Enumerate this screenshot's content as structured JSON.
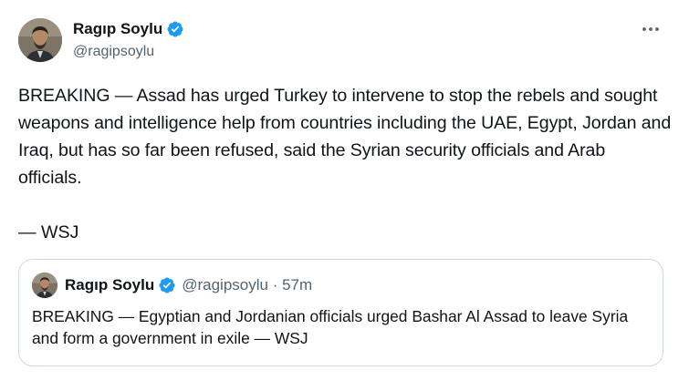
{
  "author": {
    "display_name": "Ragıp Soylu",
    "handle": "@ragipsoylu",
    "avatar_icon": "profile-avatar",
    "verified_icon": "verified-badge-icon"
  },
  "menu": {
    "icon": "more-options-icon"
  },
  "tweet": {
    "text": "BREAKING — Assad has urged Turkey to intervene to stop the rebels and sought weapons and intelligence help from countries including the UAE, Egypt, Jordan and Iraq, but has so far been refused, said the Syrian security officials and Arab officials.",
    "source": "— WSJ"
  },
  "quoted_tweet": {
    "display_name": "Ragıp Soylu",
    "meta": "@ragipsoylu · 57m",
    "text": "BREAKING — Egyptian and Jordanian officials urged Bashar Al Assad to leave Syria and form a government in exile — WSJ"
  },
  "colors": {
    "text": "#0f1419",
    "secondary": "#536471",
    "border": "#cfd9de",
    "verified": "#1d9bf0"
  }
}
